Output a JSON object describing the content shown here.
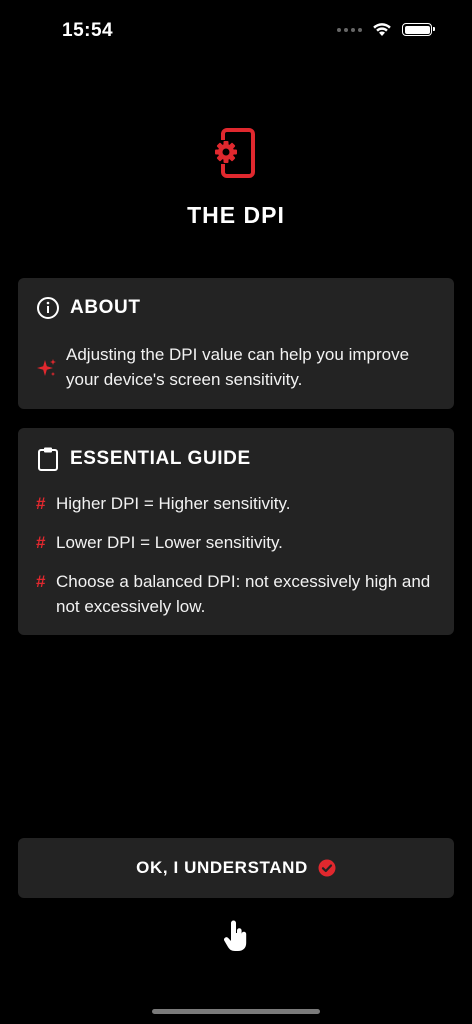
{
  "status_bar": {
    "time": "15:54"
  },
  "app": {
    "title": "THE DPI",
    "accent_color": "#e0282e"
  },
  "about": {
    "title": "ABOUT",
    "icon": "info-circle-icon",
    "text": "Adjusting the DPI value can help you improve your device's screen sensitivity."
  },
  "guide": {
    "title": "ESSENTIAL GUIDE",
    "icon": "clipboard-icon",
    "bullet": "#",
    "items": [
      {
        "text": "Higher DPI = Higher sensitivity."
      },
      {
        "text": "Lower DPI = Lower sensitivity."
      },
      {
        "text": "Choose a balanced DPI: not excessively high and not excessively low."
      }
    ]
  },
  "actions": {
    "ok_label": "OK, I UNDERSTAND"
  }
}
